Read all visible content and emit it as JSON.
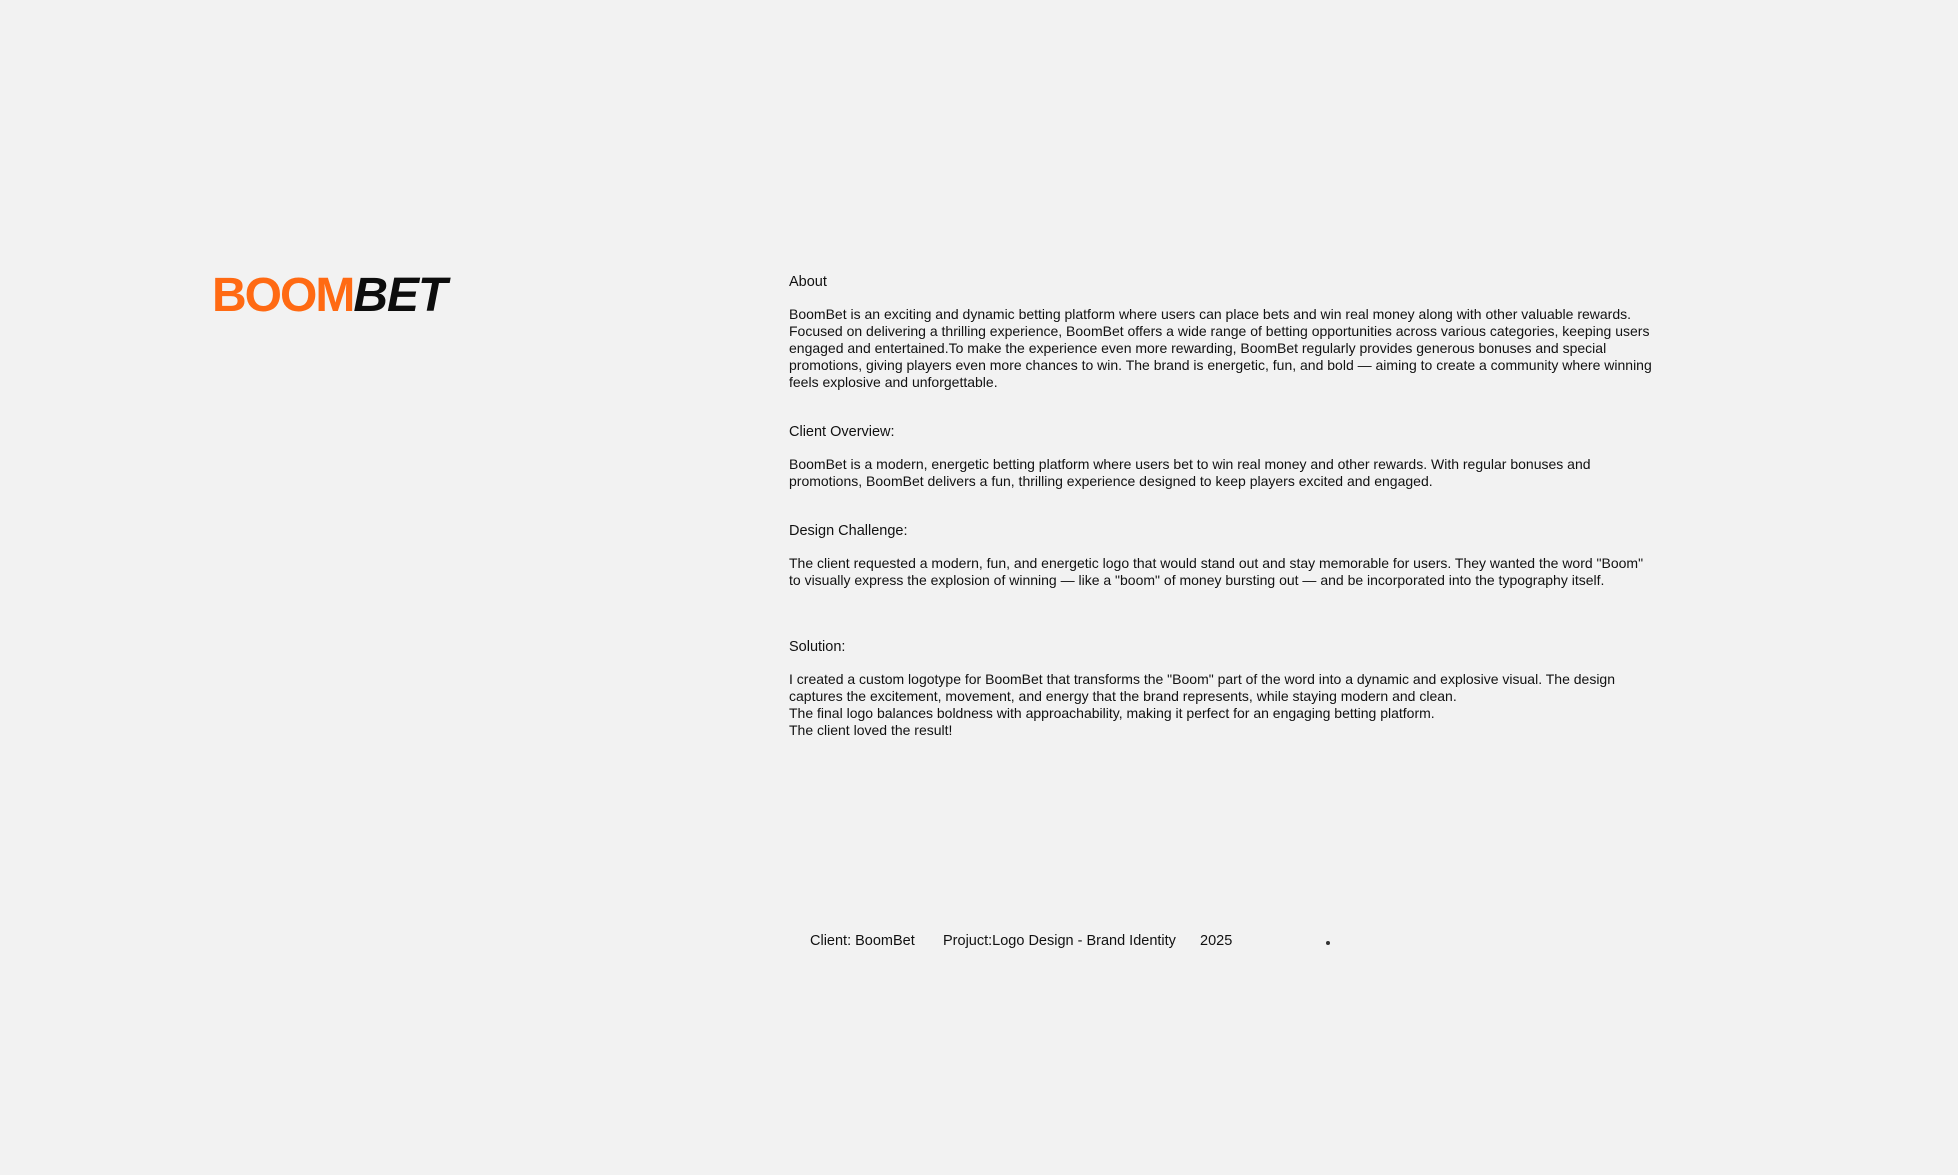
{
  "logo": {
    "boom": "BOOM",
    "bet": "BET",
    "boom_color": "#ff6a13",
    "bet_color": "#0d0d0d"
  },
  "sections": [
    {
      "title": "About",
      "body": "BoomBet is an exciting and dynamic betting platform where users can place bets and win real money along with other valuable rewards.\nFocused on delivering a thrilling experience, BoomBet offers a wide range of betting opportunities across various categories, keeping users\nengaged and entertained.To make the experience even more rewarding, BoomBet regularly provides generous bonuses and special\npromotions, giving players even more chances to win. The brand is energetic, fun, and bold — aiming to create a community where winning\nfeels explosive and unforgettable."
    },
    {
      "title": "Client Overview:",
      "body": "BoomBet is a modern, energetic betting platform where users bet to win real money and other rewards. With regular bonuses and\npromotions, BoomBet delivers a fun, thrilling experience designed to keep players excited and engaged."
    },
    {
      "title": "Design Challenge:",
      "body": "The client requested a modern, fun, and energetic logo that would stand out and stay memorable for users. They wanted the word \"Boom\"\nto visually express the explosion of winning — like a \"boom\" of money bursting out — and be incorporated into the typography itself."
    },
    {
      "title": "Solution:",
      "body": "I created a custom logotype for BoomBet that transforms the \"Boom\" part of the word into a dynamic and explosive visual. The design\ncaptures the excitement, movement, and energy that the brand represents, while staying modern and clean.\nThe final logo balances boldness with approachability, making it perfect for an engaging betting platform.\nThe client loved the result!"
    }
  ],
  "meta": {
    "client": "Client: BoomBet",
    "project": "Projuct:Logo Design - Brand Identity",
    "year": "2025"
  }
}
